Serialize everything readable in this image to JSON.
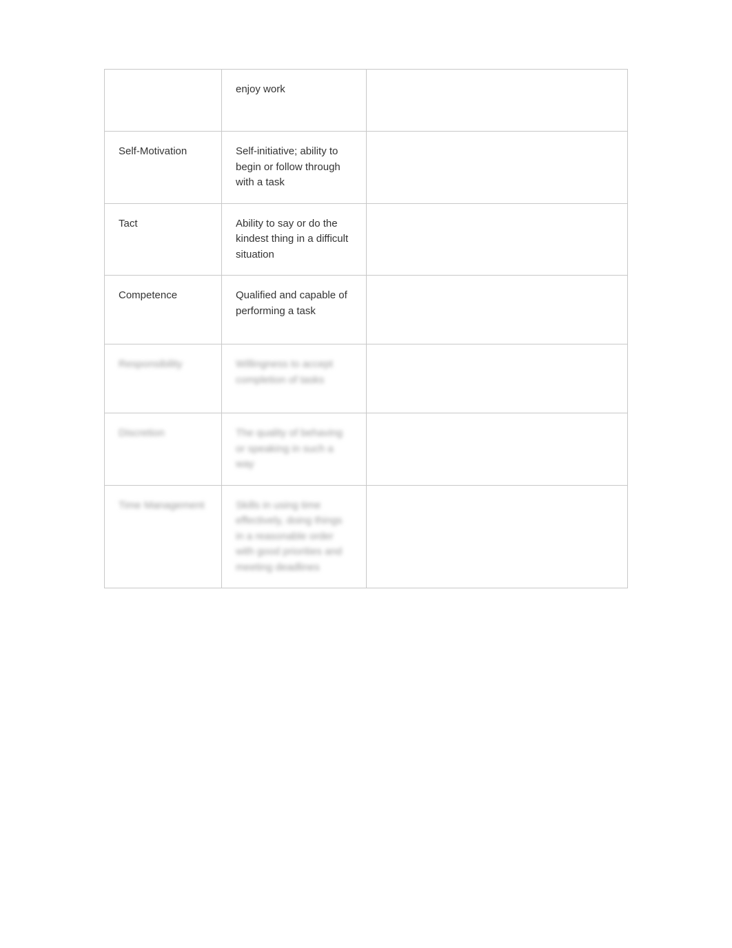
{
  "table": {
    "rows": [
      {
        "id": "row-enjoy-work",
        "col1": "",
        "col2": "enjoy work",
        "col3": "",
        "blurred": false
      },
      {
        "id": "row-self-motivation",
        "col1": "Self-Motivation",
        "col2": "Self-initiative; ability to begin or follow through with a task",
        "col3": "",
        "blurred": false
      },
      {
        "id": "row-tact",
        "col1": "Tact",
        "col2": "Ability to say or do the kindest thing in a difficult situation",
        "col3": "",
        "blurred": false
      },
      {
        "id": "row-competence",
        "col1": "Competence",
        "col2": "Qualified and capable of performing a task",
        "col3": "",
        "blurred": false
      },
      {
        "id": "row-responsibility",
        "col1": "Responsibility",
        "col2": "Willingness to accept completion of tasks",
        "col3": "",
        "blurred": true
      },
      {
        "id": "row-discretion",
        "col1": "Discretion",
        "col2": "The quality of behaving or speaking in such a way",
        "col3": "",
        "blurred": true
      },
      {
        "id": "row-time-mgmt",
        "col1": "Time Management",
        "col2": "Skills in using time effectively, doing things in a reasonable order with good priorities and meeting deadlines",
        "col3": "",
        "blurred": true
      }
    ]
  }
}
